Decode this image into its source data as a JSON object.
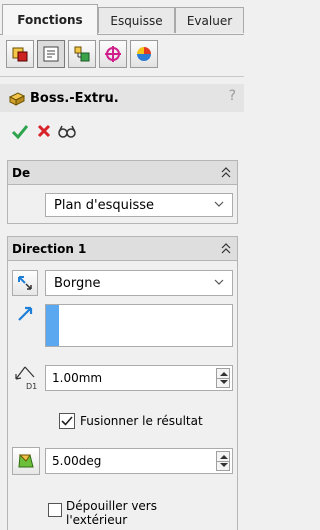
{
  "tabs": [
    {
      "label": "Fonctions",
      "active": true
    },
    {
      "label": "Esquisse",
      "active": false
    },
    {
      "label": "Evaluer",
      "active": false
    }
  ],
  "toolbar": {
    "icons": [
      "featuremanager-icon",
      "propertymanager-icon",
      "configurationmanager-icon",
      "dimxpert-icon",
      "display-manager-icon"
    ],
    "active_index": 1
  },
  "feature": {
    "title": "Boss.-Extru.",
    "help": "?",
    "actions": [
      "ok-icon",
      "cancel-icon",
      "preview-icon"
    ]
  },
  "from_group": {
    "title": "De",
    "start_condition": "Plan d'esquisse"
  },
  "direction1": {
    "title": "Direction 1",
    "end_condition": "Borgne",
    "depth": "1.00mm",
    "depth_label": "D1",
    "merge_result_label": "Fusionner le résultat",
    "merge_result_checked": true,
    "draft_angle": "5.00deg",
    "draft_outward_label_1": "Dépouiller vers",
    "draft_outward_label_2": "l'extérieur",
    "draft_outward_checked": false
  },
  "colors": {
    "accent_blue": "#1e7fd8",
    "ok_green": "#2ea44f",
    "cancel_red": "#d8232a"
  }
}
